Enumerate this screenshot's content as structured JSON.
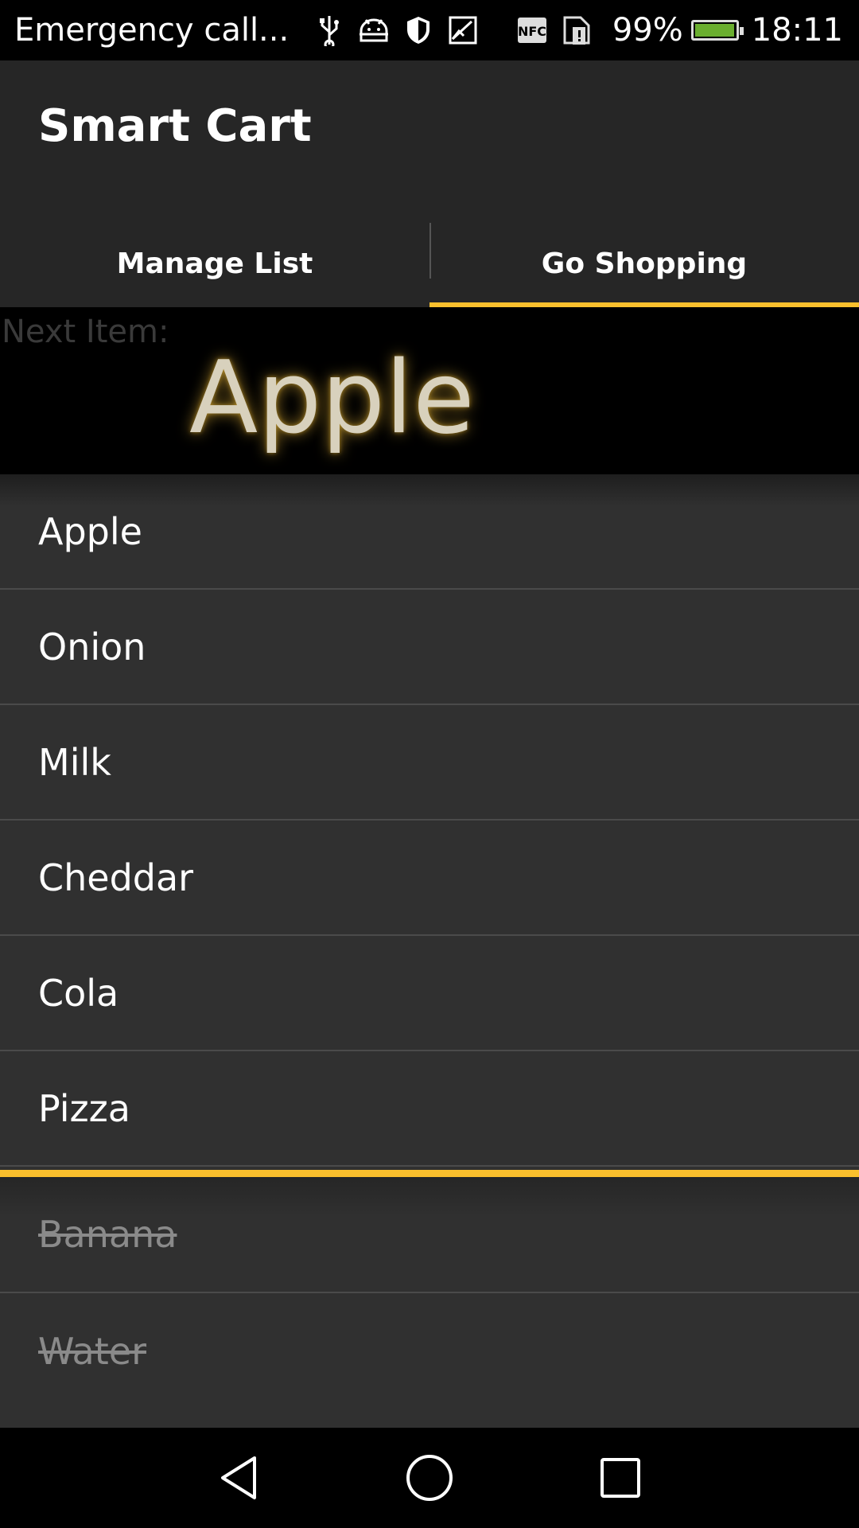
{
  "status_bar": {
    "carrier": "Emergency call...",
    "battery_percent": "99%",
    "battery_level": 0.99,
    "time": "18:11",
    "icons": [
      "usb-icon",
      "android-debug-icon",
      "shield-icon",
      "image-icon",
      "nfc-icon",
      "sim-alert-icon",
      "battery-icon"
    ]
  },
  "app": {
    "title": "Smart Cart",
    "tabs": [
      {
        "label": "Manage List",
        "active": false
      },
      {
        "label": "Go Shopping",
        "active": true
      }
    ],
    "accent_color": "#fbc02d"
  },
  "next_item": {
    "label": "Next Item:",
    "value": "Apple"
  },
  "shopping_list": {
    "pending": [
      "Apple",
      "Onion",
      "Milk",
      "Cheddar",
      "Cola",
      "Pizza"
    ],
    "done": [
      "Banana",
      "Water"
    ]
  },
  "nav_bar": {
    "buttons": [
      "back-icon",
      "home-icon",
      "recents-icon"
    ]
  }
}
